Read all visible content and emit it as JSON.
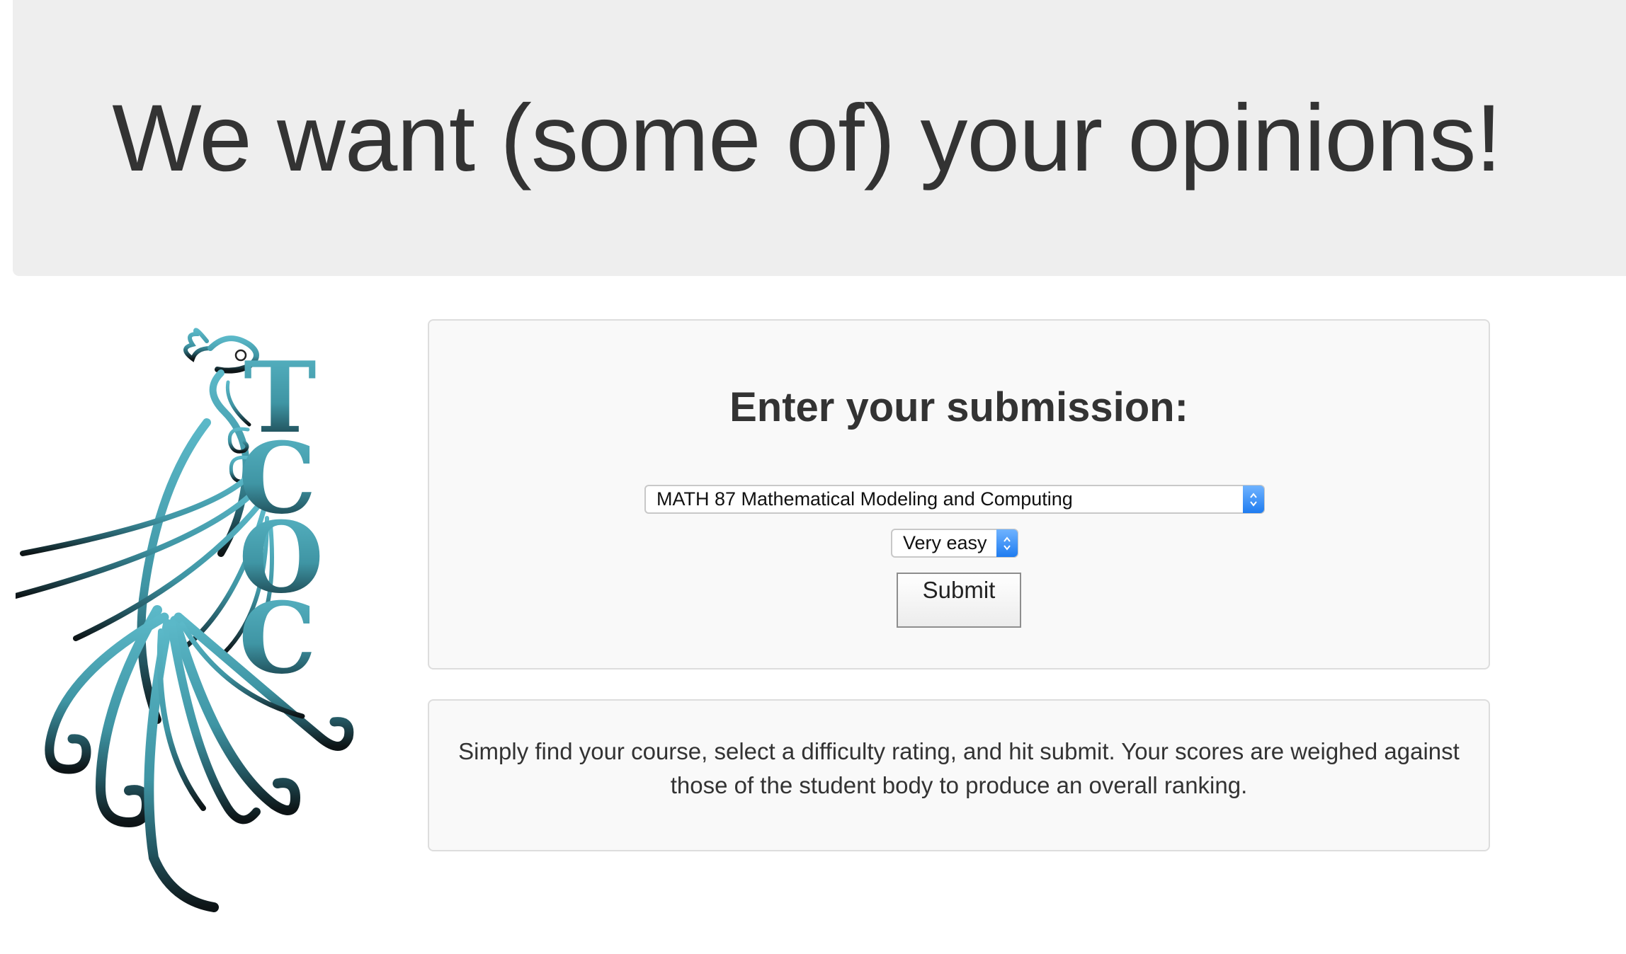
{
  "header": {
    "title": "We want (some of) your opinions!"
  },
  "logo": {
    "text": "TCOC",
    "colors": {
      "top": "#5bb8c8",
      "bottom": "#0d1416"
    }
  },
  "form": {
    "title": "Enter your submission:",
    "course_select": {
      "value": "MATH 87 Mathematical Modeling and Computing"
    },
    "rating_select": {
      "value": "Very easy"
    },
    "submit_label": "Submit"
  },
  "info": {
    "text": "Simply find your course, select a difficulty rating, and hit submit. Your scores are weighed against those of the student body to produce an overall ranking."
  },
  "colors": {
    "jumbotron_bg": "#eeeeee",
    "panel_bg": "#f9f9f9",
    "panel_border": "#dddddd",
    "select_accent": "#1f7cf0"
  }
}
